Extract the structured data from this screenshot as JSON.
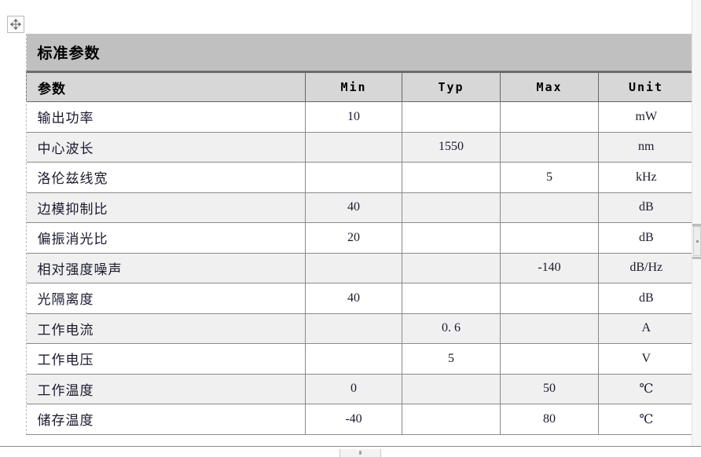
{
  "document": {
    "table_caption": "标准参数",
    "move_handle_icon": "move-cross-icon"
  },
  "table": {
    "columns": [
      {
        "key": "param",
        "label": "参数",
        "align": "left"
      },
      {
        "key": "min",
        "label": "Min",
        "align": "center"
      },
      {
        "key": "typ",
        "label": "Typ",
        "align": "center"
      },
      {
        "key": "max",
        "label": "Max",
        "align": "center"
      },
      {
        "key": "unit",
        "label": "Unit",
        "align": "center"
      }
    ],
    "rows": [
      {
        "param": "输出功率",
        "min": "10",
        "typ": "",
        "max": "",
        "unit": "mW"
      },
      {
        "param": "中心波长",
        "min": "",
        "typ": "1550",
        "max": "",
        "unit": "nm"
      },
      {
        "param": "洛伦兹线宽",
        "min": "",
        "typ": "",
        "max": "5",
        "unit": "kHz"
      },
      {
        "param": "边模抑制比",
        "min": "40",
        "typ": "",
        "max": "",
        "unit": "dB"
      },
      {
        "param": "偏振消光比",
        "min": "20",
        "typ": "",
        "max": "",
        "unit": "dB"
      },
      {
        "param": "相对强度噪声",
        "min": "",
        "typ": "",
        "max": "-140",
        "unit": "dB/Hz"
      },
      {
        "param": "光隔离度",
        "min": "40",
        "typ": "",
        "max": "",
        "unit": "dB"
      },
      {
        "param": "工作电流",
        "min": "",
        "typ": "0. 6",
        "max": "",
        "unit": "A"
      },
      {
        "param": "工作电压",
        "min": "",
        "typ": "5",
        "max": "",
        "unit": "V"
      },
      {
        "param": "工作温度",
        "min": "0",
        "typ": "",
        "max": "50",
        "unit": "℃"
      },
      {
        "param": "储存温度",
        "min": "-40",
        "typ": "",
        "max": "80",
        "unit": "℃"
      }
    ]
  },
  "colors": {
    "caption_band": "#c0c0c0",
    "header_band": "#d7d7d7",
    "row_alt": "#f0f0f0",
    "row_plain": "#ffffff",
    "grid_line": "#8a8a8a",
    "text": "#1a1a2e"
  },
  "scrollbars": {
    "vertical_icon": "vertical-scrollbar",
    "horizontal_icon": "horizontal-scrollbar"
  }
}
